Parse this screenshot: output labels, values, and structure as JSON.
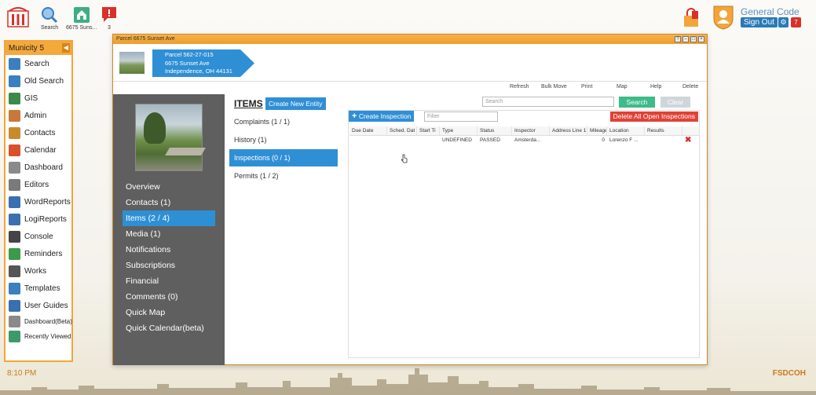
{
  "topbar": {
    "buttons": [
      {
        "label": "Search",
        "icon": "search-icon"
      },
      {
        "label": "6675 Suns...",
        "icon": "house-icon"
      },
      {
        "label": "3",
        "icon": "alert-icon"
      }
    ],
    "user": {
      "name": "General Code",
      "sign_out": "Sign Out",
      "badge_count": "7"
    }
  },
  "leftnav": {
    "header": "Municity 5",
    "items": [
      {
        "label": "Search",
        "icon": "search-icon",
        "color": "#3a7fc0"
      },
      {
        "label": "Old Search",
        "icon": "search-icon",
        "color": "#3a7fc0"
      },
      {
        "label": "GIS",
        "icon": "map-icon",
        "color": "#3c8a4a"
      },
      {
        "label": "Admin",
        "icon": "user-icon",
        "color": "#c9773a"
      },
      {
        "label": "Contacts",
        "icon": "contacts-icon",
        "color": "#c98a2a"
      },
      {
        "label": "Calendar",
        "icon": "calendar-icon",
        "color": "#d9502a"
      },
      {
        "label": "Dashboard",
        "icon": "dashboard-icon",
        "color": "#8a8a8a"
      },
      {
        "label": "Editors",
        "icon": "editor-icon",
        "color": "#7a7a7a"
      },
      {
        "label": "WordReports",
        "icon": "word-icon",
        "color": "#3a6fb0"
      },
      {
        "label": "LogiReports",
        "icon": "report-icon",
        "color": "#3a6fb0"
      },
      {
        "label": "Console",
        "icon": "console-icon",
        "color": "#444444"
      },
      {
        "label": "Reminders",
        "icon": "clock-icon",
        "color": "#3c9a4a"
      },
      {
        "label": "Works",
        "icon": "helmet-icon",
        "color": "#555555"
      },
      {
        "label": "Templates",
        "icon": "template-icon",
        "color": "#3a7fc0"
      },
      {
        "label": "User Guides",
        "icon": "guide-icon",
        "color": "#3a6fb0"
      }
    ],
    "small_items": [
      {
        "label": "Dashboard(Beta)",
        "icon": "dashboard-icon",
        "color": "#8a8a8a"
      },
      {
        "label": "Recently Viewed",
        "icon": "recent-icon",
        "color": "#3c9a6a"
      }
    ]
  },
  "footer": {
    "time": "8:10 PM",
    "site": "FSDCOH"
  },
  "window": {
    "title": "Parcel 6675 Sunset Ave",
    "parcel": {
      "line1": "Parcel 562-27-015",
      "line2": "6675 Sunset Ave",
      "line3": "Independence, OH 44131"
    },
    "toolbar": [
      "Refresh",
      "Bulk Move",
      "Print",
      "Map",
      "Help",
      "Delete"
    ],
    "left_menu": [
      {
        "label": "Overview",
        "active": false
      },
      {
        "label": "Contacts (1)",
        "active": false
      },
      {
        "label": "Items (2 / 4)",
        "active": true
      },
      {
        "label": "Media (1)",
        "active": false
      },
      {
        "label": "Notifications",
        "active": false
      },
      {
        "label": "Subscriptions",
        "active": false
      },
      {
        "label": "Financial",
        "active": false
      },
      {
        "label": "Comments (0)",
        "active": false
      },
      {
        "label": "Quick Map",
        "active": false
      },
      {
        "label": "Quick Calendar(beta)",
        "active": false
      }
    ],
    "items_title": "ITEMS",
    "create_entity": "Create New Entity",
    "sub_items": [
      {
        "label": "Complaints (1 / 1)",
        "active": false
      },
      {
        "label": "History (1)",
        "active": false
      },
      {
        "label": "Inspections (0 / 1)",
        "active": true
      },
      {
        "label": "Permits (1 / 2)",
        "active": false
      }
    ],
    "search_placeholder": "Search",
    "search_btn": "Search",
    "clear_btn": "Clear",
    "create_inspection": "Create Inspection",
    "filter_placeholder": "Filter",
    "delete_all": "Delete All Open Inspections",
    "grid": {
      "headers": [
        "Due Date",
        "Sched. Dat",
        "Start Ti",
        "Type",
        "Status",
        "Inspector",
        "Address Line 1",
        "Mileage",
        "Location",
        "Results",
        ""
      ],
      "rows": [
        [
          "",
          "",
          "",
          "UNDEFINED",
          "PASSED",
          "Amsterda...",
          "",
          "0",
          "Lorenzo F ...",
          "",
          ""
        ]
      ]
    }
  }
}
